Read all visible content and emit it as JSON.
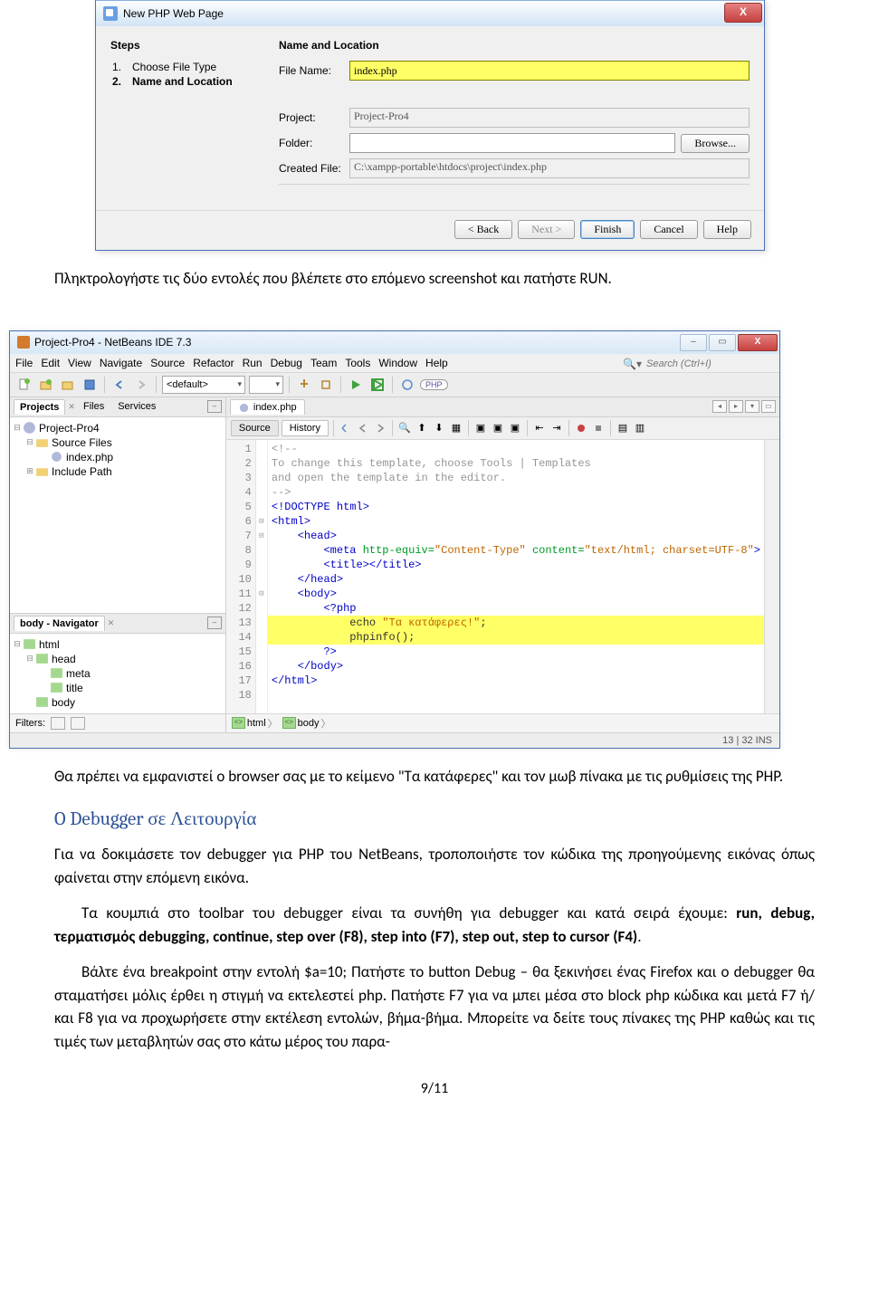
{
  "dialog": {
    "title": "New PHP Web Page",
    "steps_header": "Steps",
    "form_header": "Name and Location",
    "steps": [
      {
        "num": "1.",
        "text": "Choose File Type",
        "current": false
      },
      {
        "num": "2.",
        "text": "Name and Location",
        "current": true
      }
    ],
    "labels": {
      "file_name": "File Name:",
      "project": "Project:",
      "folder": "Folder:",
      "created_file": "Created File:",
      "browse": "Browse..."
    },
    "values": {
      "file_name": "index.php",
      "project": "Project-Pro4",
      "folder": "",
      "created_file": "C:\\xampp-portable\\htdocs\\project\\index.php"
    },
    "buttons": {
      "back": "< Back",
      "next": "Next >",
      "finish": "Finish",
      "cancel": "Cancel",
      "help": "Help"
    }
  },
  "intro_text": "Πληκτρολογήστε τις δύο εντολές που βλέπετε στο επόμενο screenshot και πατήστε RUN.",
  "ide": {
    "title": "Project-Pro4 - NetBeans IDE 7.3",
    "menu": [
      "File",
      "Edit",
      "View",
      "Navigate",
      "Source",
      "Refactor",
      "Run",
      "Debug",
      "Team",
      "Tools",
      "Window",
      "Help"
    ],
    "search_placeholder": "Search (Ctrl+I)",
    "config_combo": "<default>",
    "php_badge": "PHP",
    "projects": {
      "tabs": [
        "Projects",
        "Files",
        "Services"
      ],
      "root": "Project-Pro4",
      "nodes": [
        {
          "name": "Source Files",
          "children": [
            "index.php"
          ]
        },
        {
          "name": "Include Path",
          "children": []
        }
      ]
    },
    "navigator": {
      "title": "body - Navigator",
      "items": [
        "html",
        "head",
        "meta",
        "title",
        "body"
      ]
    },
    "filters_label": "Filters:",
    "editor": {
      "tab": "index.php",
      "mode_source": "Source",
      "mode_history": "History",
      "lines": [
        {
          "n": 1,
          "cls": "cmt",
          "txt": "<!--"
        },
        {
          "n": 2,
          "cls": "cmt",
          "txt": "To change this template, choose Tools | Templates"
        },
        {
          "n": 3,
          "cls": "cmt",
          "txt": "and open the template in the editor."
        },
        {
          "n": 4,
          "cls": "cmt",
          "txt": "-->"
        },
        {
          "n": 5,
          "cls": "",
          "txt": "<!DOCTYPE html>",
          "html": "<span class='tag'>&lt;!DOCTYPE html&gt;</span>"
        },
        {
          "n": 6,
          "cls": "",
          "txt": "<html>",
          "html": "<span class='tag'>&lt;html&gt;</span>"
        },
        {
          "n": 7,
          "cls": "",
          "txt": "    <head>",
          "html": "    <span class='tag'>&lt;head&gt;</span>"
        },
        {
          "n": 8,
          "cls": "",
          "txt": "        <meta http-equiv=\"Content-Type\" content=\"text/html; charset=UTF-8\">",
          "html": "        <span class='tag'>&lt;meta</span> <span class='attr'>http-equiv=</span><span class='txt'>\"Content-Type\"</span> <span class='attr'>content=</span><span class='txt'>\"text/html; charset=UTF-8\"</span><span class='tag'>&gt;</span>"
        },
        {
          "n": 9,
          "cls": "",
          "txt": "        <title></title>",
          "html": "        <span class='tag'>&lt;title&gt;&lt;/title&gt;</span>"
        },
        {
          "n": 10,
          "cls": "",
          "txt": "    </head>",
          "html": "    <span class='tag'>&lt;/head&gt;</span>"
        },
        {
          "n": 11,
          "cls": "",
          "txt": "    <body>",
          "html": "    <span class='tag'>&lt;body&gt;</span>"
        },
        {
          "n": 12,
          "cls": "",
          "txt": "        <?php",
          "html": "        <span class='key'>&lt;?php</span>"
        },
        {
          "n": 13,
          "cls": "hl",
          "txt": "            echo \"Τα κατάφερες!\";",
          "html": "            echo <span class='txt'>\"Τα κατάφερες!\"</span>;"
        },
        {
          "n": 14,
          "cls": "hl",
          "txt": "            phpinfo();",
          "html": "            phpinfo();"
        },
        {
          "n": 15,
          "cls": "",
          "txt": "        ?>",
          "html": "        <span class='key'>?&gt;</span>"
        },
        {
          "n": 16,
          "cls": "",
          "txt": "    </body>",
          "html": "    <span class='tag'>&lt;/body&gt;</span>"
        },
        {
          "n": 17,
          "cls": "",
          "txt": "</html>",
          "html": "<span class='tag'>&lt;/html&gt;</span>"
        },
        {
          "n": 18,
          "cls": "",
          "txt": "",
          "html": ""
        }
      ],
      "breadcrumb": [
        "html",
        "body"
      ],
      "status": "13 | 32   INS"
    }
  },
  "article": {
    "p1": "Θα πρέπει να εμφανιστεί ο browser σας με το κείμενο \"Τα κατάφερες\" και τον μωβ πίνακα με τις ρυθμίσεις της PHP.",
    "h": "O Debugger σε Λειτουργία",
    "p2": "Για να δοκιμάσετε τον debugger για PHP του NetBeans, τροποποιήστε τον κώδικα της προηγούμενης εικόνας όπως φαίνεται στην επόμενη εικόνα.",
    "p3_a": "Τα κουμπιά στο toolbar του debugger είναι τα συνήθη για debugger και κατά σειρά έχουμε: ",
    "p3_b": "run, debug, τερματισμός debugging, continue, step over (F8), step into (F7), step out, step to cursor (F4)",
    "p3_c": ".",
    "p4": "Βάλτε ένα breakpoint στην εντολή $a=10; Πατήστε το button Debug – θα ξεκινήσει ένας Firefox και ο debugger θα σταματήσει μόλις έρθει η στιγμή να εκτελεστεί php. Πατήστε F7 για να μπει μέσα στο block php κώδικα και μετά F7 ή/και F8 για να προχωρήσετε στην εκτέλεση εντολών, βήμα-βήμα. Μπορείτε να δείτε τους πίνακες της PHP καθώς και τις τιμές των μεταβλητών σας στο κάτω μέρος του παρα-"
  },
  "page_num": "9/11"
}
